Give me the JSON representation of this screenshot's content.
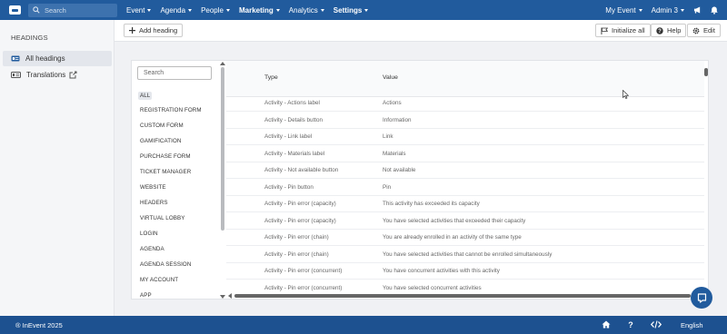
{
  "topbar": {
    "search_placeholder": "Search",
    "nav": [
      {
        "label": "Event",
        "bold": false
      },
      {
        "label": "Agenda",
        "bold": false
      },
      {
        "label": "People",
        "bold": false
      },
      {
        "label": "Marketing",
        "bold": true
      },
      {
        "label": "Analytics",
        "bold": false
      },
      {
        "label": "Settings",
        "bold": true
      }
    ],
    "my_event": "My Event",
    "admin": "Admin 3"
  },
  "sidebar": {
    "title": "HEADINGS",
    "items": [
      {
        "label": "All headings",
        "active": true,
        "icon": "id-card-icon"
      },
      {
        "label": "Translations",
        "active": false,
        "icon": "translate-icon"
      }
    ]
  },
  "toolbar": {
    "add_heading": "Add heading",
    "initialize_all": "Initialize all",
    "help": "Help",
    "edit": "Edit"
  },
  "filter": {
    "search_placeholder": "Search",
    "categories": [
      "ALL",
      "REGISTRATION FORM",
      "CUSTOM FORM",
      "GAMIFICATION",
      "PURCHASE FORM",
      "TICKET MANAGER",
      "WEBSITE",
      "HEADERS",
      "VIRTUAL LOBBY",
      "LOGIN",
      "AGENDA",
      "AGENDA SESSION",
      "MY ACCOUNT",
      "APP"
    ]
  },
  "table": {
    "columns": [
      "Type",
      "Value"
    ],
    "rows": [
      {
        "type": "Activity - Actions label",
        "value": "Actions"
      },
      {
        "type": "Activity - Details button",
        "value": "Information"
      },
      {
        "type": "Activity - Link label",
        "value": "Link"
      },
      {
        "type": "Activity - Materials label",
        "value": "Materials"
      },
      {
        "type": "Activity - Not available button",
        "value": "Not available"
      },
      {
        "type": "Activity - Pin button",
        "value": "Pin"
      },
      {
        "type": "Activity - Pin error (capacity)",
        "value": "This activity has exceeded its capacity"
      },
      {
        "type": "Activity - Pin error (capacity)",
        "value": "You have selected activities that exceeded their capacity"
      },
      {
        "type": "Activity - Pin error (chain)",
        "value": "You are already enrolled in an activity of the same type"
      },
      {
        "type": "Activity - Pin error (chain)",
        "value": "You have selected activities that cannot be enrolled simultaneously"
      },
      {
        "type": "Activity - Pin error (concurrent)",
        "value": "You have concurrent activities with this activity"
      },
      {
        "type": "Activity - Pin error (concurrent)",
        "value": "You have selected concurrent activities"
      }
    ]
  },
  "footer": {
    "copyright": "® InEvent 2025",
    "language": "English"
  },
  "colors": {
    "primary": "#215b9d",
    "footer": "#1d5190",
    "background": "#f0f1f4"
  }
}
